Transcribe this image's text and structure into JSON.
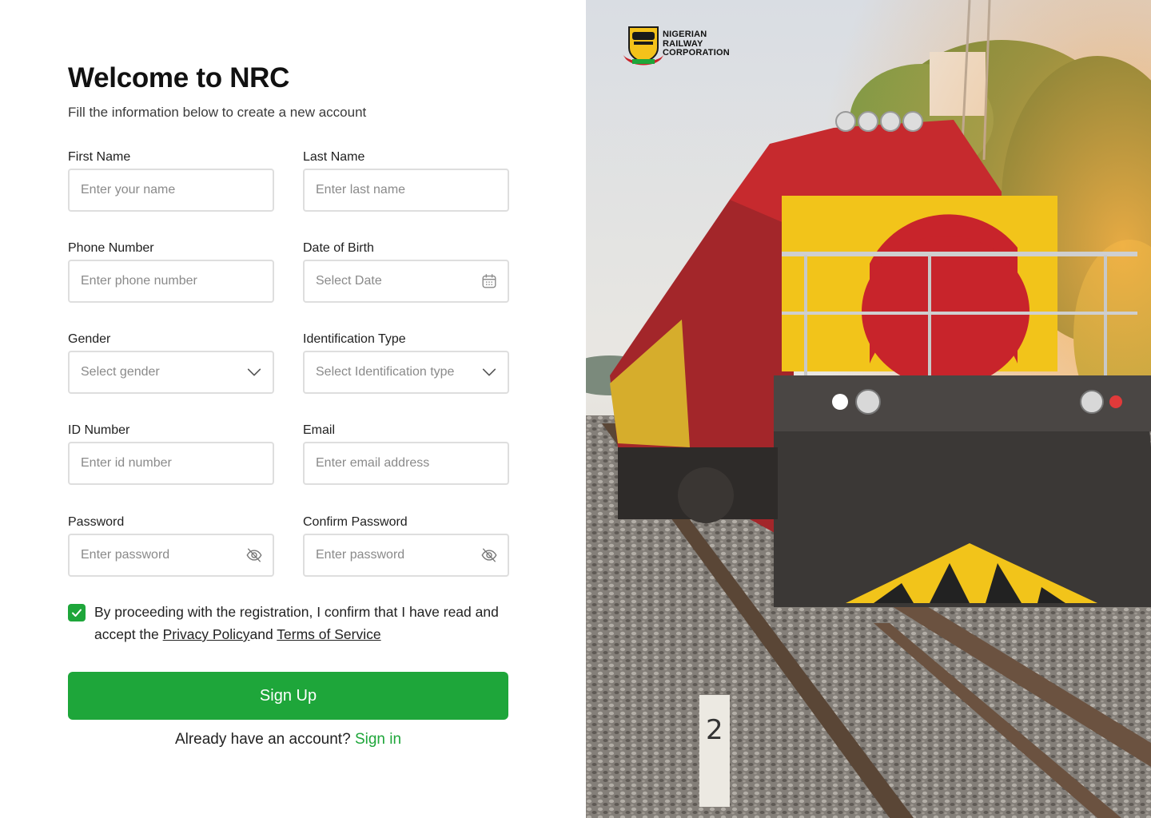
{
  "form": {
    "title": "Welcome to NRC",
    "subtitle": "Fill the information below to create a new account",
    "fields": {
      "first_name": {
        "label": "First Name",
        "placeholder": "Enter your name"
      },
      "last_name": {
        "label": "Last Name",
        "placeholder": "Enter last name"
      },
      "phone": {
        "label": "Phone Number",
        "placeholder": "Enter phone number"
      },
      "dob": {
        "label": "Date of Birth",
        "placeholder": "Select Date",
        "icon": "calendar-icon"
      },
      "gender": {
        "label": "Gender",
        "placeholder": "Select gender",
        "icon": "chevron-down-icon"
      },
      "id_type": {
        "label": "Identification Type",
        "placeholder": "Select Identification type",
        "icon": "chevron-down-icon"
      },
      "id_number": {
        "label": "ID Number",
        "placeholder": "Enter id number"
      },
      "email": {
        "label": "Email",
        "placeholder": "Enter email address"
      },
      "password": {
        "label": "Password",
        "placeholder": "Enter password",
        "icon": "eye-off-icon"
      },
      "confirm_password": {
        "label": "Confirm Password",
        "placeholder": "Enter password",
        "icon": "eye-off-icon"
      }
    },
    "consent": {
      "checked": true,
      "text_before": "By proceeding with the registration, I confirm that I have read and accept the ",
      "privacy_link": "Privacy Policy",
      "text_middle": "and ",
      "terms_link": "Terms of Service"
    },
    "signup_label": "Sign Up",
    "signin_prompt": "Already have an account?",
    "signin_link": "Sign in"
  },
  "brand": {
    "line1": "NIGERIAN",
    "line2": "RAILWAY",
    "line3": "CORPORATION"
  },
  "colors": {
    "accent": "#1ea63a",
    "input_border": "#dedede",
    "locomotive_red": "#c8242b",
    "locomotive_yellow": "#f2c41a"
  }
}
